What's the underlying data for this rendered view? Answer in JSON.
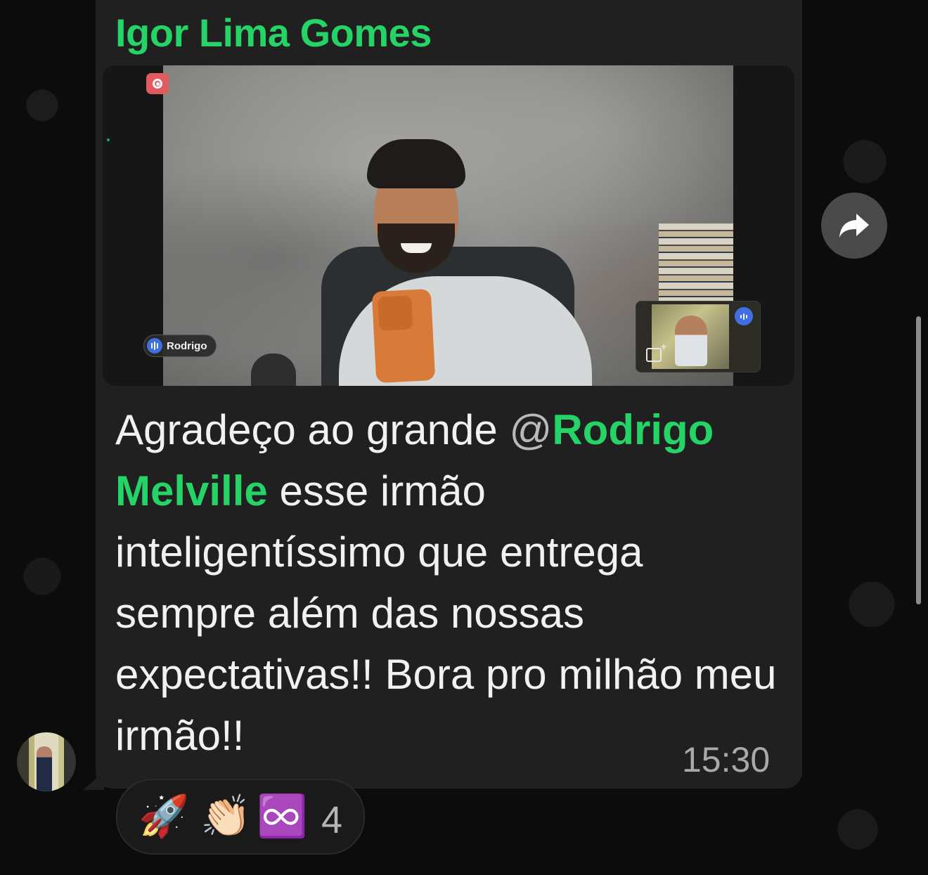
{
  "message": {
    "sender": "Igor Lima Gomes",
    "text_before": "Agradeço ao grande ",
    "mention_at": "@",
    "mention_name": "Rodrigo Melville",
    "text_after": " esse irmão inteligentíssimo que entrega sempre além das nossas expectativas!! Bora pro milhão meu irmão!!",
    "time": "15:30"
  },
  "video": {
    "participant_chip": "Rodrigo"
  },
  "reactions": {
    "items": [
      "🚀",
      "👏🏻",
      "♾️"
    ],
    "count": "4"
  },
  "icons": {
    "forward": "forward-arrow-icon",
    "record": "record-icon",
    "mic": "audio-level-icon",
    "add_image": "add-image-icon"
  },
  "colors": {
    "sender_name": "#25d366",
    "mention": "#25d366",
    "bubble": "#202020",
    "background": "#0c0c0c"
  }
}
